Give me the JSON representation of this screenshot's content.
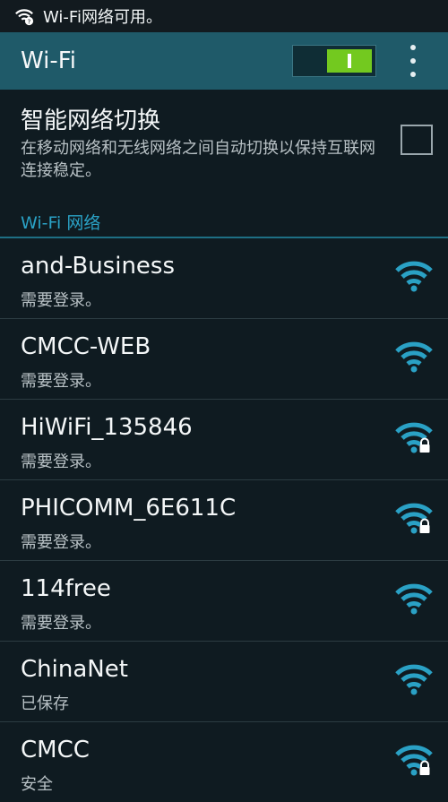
{
  "status_bar": {
    "text": "Wi-Fi网络可用。"
  },
  "app_bar": {
    "title": "Wi-Fi",
    "toggle_on": true
  },
  "smart_switch": {
    "title": "智能网络切换",
    "description": "在移动网络和无线网络之间自动切换以保持互联网连接稳定。",
    "checked": false
  },
  "section": {
    "label": "Wi-Fi 网络"
  },
  "networks": [
    {
      "name": "and-Business",
      "status": "需要登录。",
      "secured": false
    },
    {
      "name": "CMCC-WEB",
      "status": "需要登录。",
      "secured": false
    },
    {
      "name": "HiWiFi_135846",
      "status": "需要登录。",
      "secured": true
    },
    {
      "name": "PHICOMM_6E611C",
      "status": "需要登录。",
      "secured": true
    },
    {
      "name": "114free",
      "status": "需要登录。",
      "secured": false
    },
    {
      "name": "ChinaNet",
      "status": "已保存",
      "secured": false
    },
    {
      "name": "CMCC",
      "status": "安全",
      "secured": true
    }
  ],
  "colors": {
    "accent": "#2aa1c5",
    "toggle_on": "#73c91f",
    "app_bar": "#1f5a69",
    "background": "#0f1b21"
  },
  "icons": {
    "status": "wifi-question-icon",
    "open_network": "wifi-signal-icon",
    "secured_network": "wifi-lock-icon",
    "more": "more-vert-icon"
  }
}
